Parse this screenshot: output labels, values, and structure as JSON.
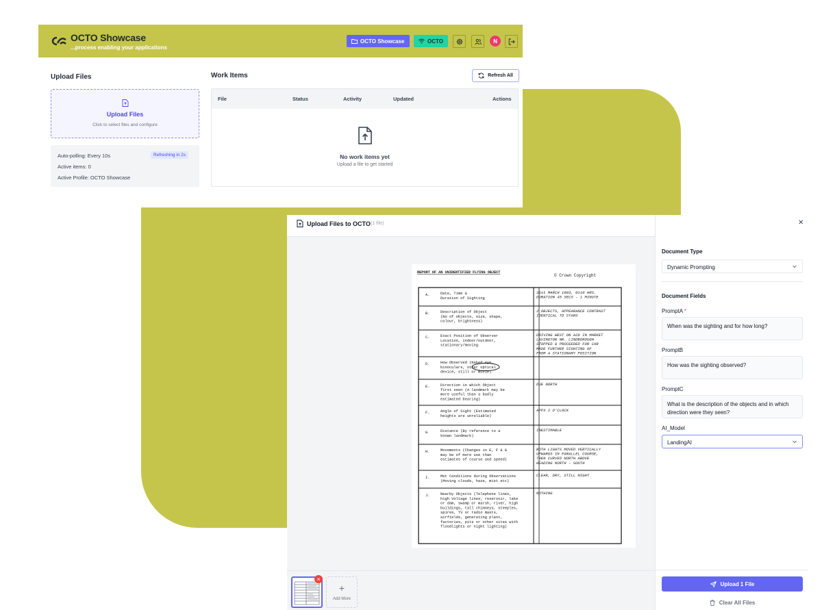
{
  "header": {
    "app_title": "OCTO Showcase",
    "app_subtitle": "...process enabling your applications",
    "profile_button": "OCTO Showcase",
    "connection_button": "OCTO",
    "avatar_initial": "N"
  },
  "upload_panel": {
    "title": "Upload Files",
    "dropzone_title": "Upload Files",
    "dropzone_hint": "Click to select files and configure",
    "auto_polling": "Auto-polling: Every 10s",
    "refresh_badge": "Refreshing in 2s",
    "active_items": "Active items: 0",
    "active_profile": "Active Profile: OCTO Showcase"
  },
  "work_items": {
    "title": "Work Items",
    "refresh_button": "Refresh All",
    "columns": [
      "File",
      "Status",
      "Activity",
      "Updated",
      "Actions"
    ],
    "empty_title": "No work items yet",
    "empty_hint": "Upload a file to get started"
  },
  "modal": {
    "title": "Upload Files to OCTO",
    "file_count": "(1 file)",
    "add_more": "Add More",
    "document": {
      "title": "REPORT OF AN UNIDENTIFIED FLYING OBJECT",
      "copyright": "© Crown Copyright",
      "rows": [
        {
          "code": "A.",
          "label": [
            "Date, Time &",
            "Duration of Sighting"
          ],
          "answer": [
            "31st MARCH 1993, 0110 HRS.",
            "DURATION 45 SECS - 1 MINUTE"
          ]
        },
        {
          "code": "B.",
          "label": [
            "Description of Object",
            "(No of objects, size, shape,",
            "colour, brightness)"
          ],
          "answer": [
            "2 OBJECTS, APPEARANCE CONTRAST",
            "IDENTICAL TO STARS"
          ]
        },
        {
          "code": "C.",
          "label": [
            "Exact Position of Observer",
            "Location, indoor/outdoor,",
            "stationary/moving"
          ],
          "answer": [
            "DRIVING WEST ON A28 IN MARKET",
            "LAVINGTON NR. LINDBOROUGH",
            "STOPPED & PROCEEDED FOR CAR",
            "MADE FURTHER SIGHTING OF",
            "FROM A STATIONARY POSITION"
          ]
        },
        {
          "code": "D.",
          "label": [
            "How Observed (Naked eye,",
            "binoculars, other optical",
            "device, still or movie)"
          ],
          "answer": []
        },
        {
          "code": "E.",
          "label": [
            "Direction in which Object",
            "first seen (A landmark may be",
            "more useful than a badly",
            "estimated bearing)"
          ],
          "answer": [
            "DUE NORTH"
          ]
        },
        {
          "code": "F.",
          "label": [
            "Angle of Sight (Estimated",
            "heights are unreliable)"
          ],
          "answer": [
            "APPX 2 O'CLOCK"
          ]
        },
        {
          "code": "G",
          "label": [
            "Distance (By reference to a",
            "known landmark)"
          ],
          "answer": [
            "INESTIMABLE"
          ]
        },
        {
          "code": "H.",
          "label": [
            "Movements (Changes in E, F & G",
            "may be of more use than",
            "estimates of course and speed)"
          ],
          "answer": [
            "BOTH LIGHTS MOVED VERTICALLY",
            "UPWARDS IN PARALLEL COURSE,",
            "THEN CURVED NORTH ABOVE",
            "HEADING NORTH - SOUTH"
          ]
        },
        {
          "code": "I.",
          "label": [
            "Met Conditions during Observations",
            "(Moving clouds, haze, mist etc)"
          ],
          "answer": [
            "CLEAR, DRY, STILL NIGHT"
          ]
        },
        {
          "code": "J.",
          "label": [
            "Nearby Objects (Telephone lines,",
            "high Voltage lines, reservoir, lake",
            "or dam, swamp or marsh, river, high",
            "buildings, tall chimneys, steeples,",
            "spires, TV or radio masts,",
            "airfields, generating plant,",
            "factories, pits or other sites with",
            "floodlights or night lighting)"
          ],
          "answer": [
            "NOTHING"
          ]
        }
      ]
    }
  },
  "config": {
    "document_type_label": "Document Type",
    "document_type_value": "Dynamic Prompting",
    "document_fields_label": "Document Fields",
    "fields": [
      {
        "label": "PromptA",
        "required": "*",
        "value": "When was the sighting and for how long?"
      },
      {
        "label": "PromptB",
        "required": "",
        "value": "How was the sighting observed?"
      },
      {
        "label": "PromptC",
        "required": "",
        "value": "What is the description of the objects and in which direction were they seen?"
      }
    ],
    "ai_model_label": "AI_Model",
    "ai_model_value": "LandingAI",
    "upload_button": "Upload 1 File",
    "clear_button": "Clear All Files"
  },
  "colors": {
    "brand_olive": "#c5c54c",
    "accent_indigo": "#6366f1",
    "accent_teal": "#22d3a5",
    "avatar_pink": "#ec3a6c"
  },
  "icons": {
    "logo": "octo-logo-icon",
    "profile": "folder-icon",
    "connection": "wifi-icon",
    "settings": "gear-icon",
    "users": "users-icon",
    "logout": "logout-icon",
    "refresh": "refresh-icon",
    "upload": "file-upload-icon",
    "close": "close-icon",
    "send": "send-icon",
    "trash": "trash-icon"
  }
}
